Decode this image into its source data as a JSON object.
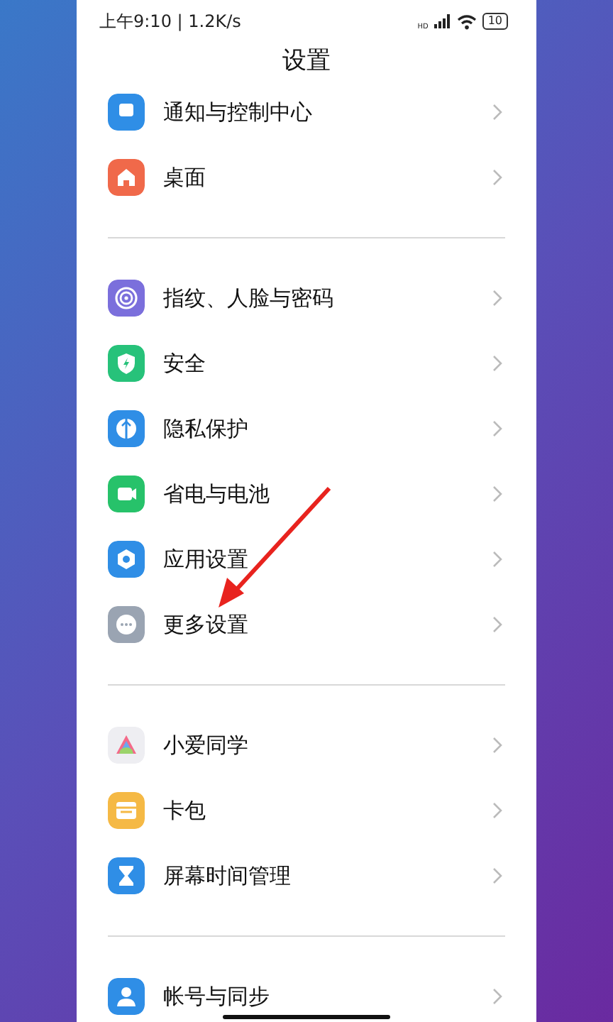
{
  "status_bar": {
    "time": "上午9:10 | 1.2K/s",
    "network": "HD",
    "battery": "10"
  },
  "title": "设置",
  "groups": [
    {
      "items": [
        {
          "label": "通知与控制中心",
          "color": "#2f8ee6"
        },
        {
          "label": "桌面",
          "color": "#f0694a"
        }
      ]
    },
    {
      "items": [
        {
          "label": "指纹、人脸与密码",
          "color": "#7b6fdc"
        },
        {
          "label": "安全",
          "color": "#27c27a"
        },
        {
          "label": "隐私保护",
          "color": "#2f8ee6"
        },
        {
          "label": "省电与电池",
          "color": "#27c26a"
        },
        {
          "label": "应用设置",
          "color": "#2f8ee6"
        },
        {
          "label": "更多设置",
          "color": "#9aa4b2"
        }
      ]
    },
    {
      "items": [
        {
          "label": "小爱同学",
          "color": "#eeeef2"
        },
        {
          "label": "卡包",
          "color": "#f5b945"
        },
        {
          "label": "屏幕时间管理",
          "color": "#2f8ee6"
        }
      ]
    },
    {
      "items": [
        {
          "label": "帐号与同步",
          "color": "#2f8ee6"
        }
      ]
    }
  ]
}
